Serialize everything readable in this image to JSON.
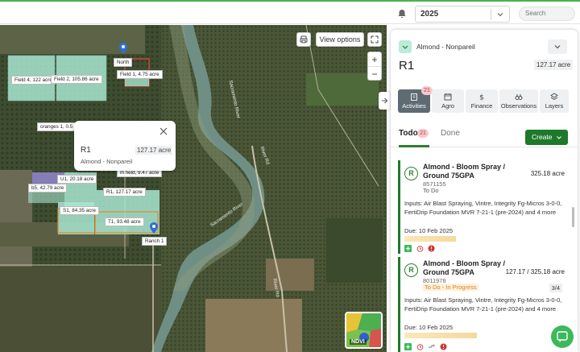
{
  "topbar": {
    "year": "2025",
    "search_placeholder": "Search"
  },
  "map": {
    "view_options_label": "View options",
    "zoom_in": "+",
    "zoom_out": "−",
    "field_labels": [
      "Field 4, 122 acre",
      "Field 2, 105.86 acre",
      "North",
      "Field 1, 4.75 acre",
      "oranges 1, 0.5",
      "U1, 20.18 acre",
      "b5, 42.79 acre",
      "R1, 127.17 acre",
      "S1, 84.35 acre",
      "T1, 93.48 acre",
      "Ranch 1",
      "m field, 9.47 acre"
    ],
    "river_labels": [
      "Sacramento River",
      "Sacramento River",
      "River Rd",
      "River Rd"
    ],
    "popup": {
      "title": "R1",
      "area": "127.17 acre",
      "crop": "Almond - Nonpareil"
    },
    "ndvi_label": "NDVI"
  },
  "panel": {
    "crop": "Almond - Nonpareil",
    "field_name": "R1",
    "field_area": "127.17 acre",
    "tabs": [
      {
        "label": "Activities",
        "icon": "clipboard-icon",
        "badge": "21"
      },
      {
        "label": "Agro",
        "icon": "calendar-icon"
      },
      {
        "label": "Finance",
        "icon": "dollar-icon"
      },
      {
        "label": "Observations",
        "icon": "binoculars-icon"
      },
      {
        "label": "Layers",
        "icon": "layers-icon"
      }
    ],
    "subtabs": {
      "todo": "Todo",
      "todo_count": "21",
      "done": "Done",
      "create": "Create"
    },
    "activities": [
      {
        "status_letter": "R",
        "title": "Almond - Bloom Spray / Ground 75GPA",
        "acre": "325.18 acre",
        "code": "8571155",
        "status": "To Do",
        "inputs": "Inputs: Air Blast Spraying, Vintre, Integrity Fg-Micros 3-0-0, FertiDrip Foundation MVR 7-21-1 (pre-2024) and 4 more",
        "due": "Due: 10 Feb 2025"
      },
      {
        "status_letter": "R",
        "title": "Almond - Bloom Spray / Ground 75GPA",
        "acre": "127.17 / 325.18 acre",
        "code": "8011978",
        "status": "To Do - In Progress",
        "step": "3/4",
        "inputs": "Inputs: Air Blast Spraying, Vintre, Integrity Fg-Micros 3-0-0, FertiDrip Foundation MVR 7-21-1 (pre-2024) and 4 more",
        "due": "Due: 10 Feb 2025"
      }
    ]
  },
  "colors": {
    "brand_green": "#1e7a2b",
    "badge_pink": "#f5c8cf",
    "in_progress": "#d9822b"
  }
}
